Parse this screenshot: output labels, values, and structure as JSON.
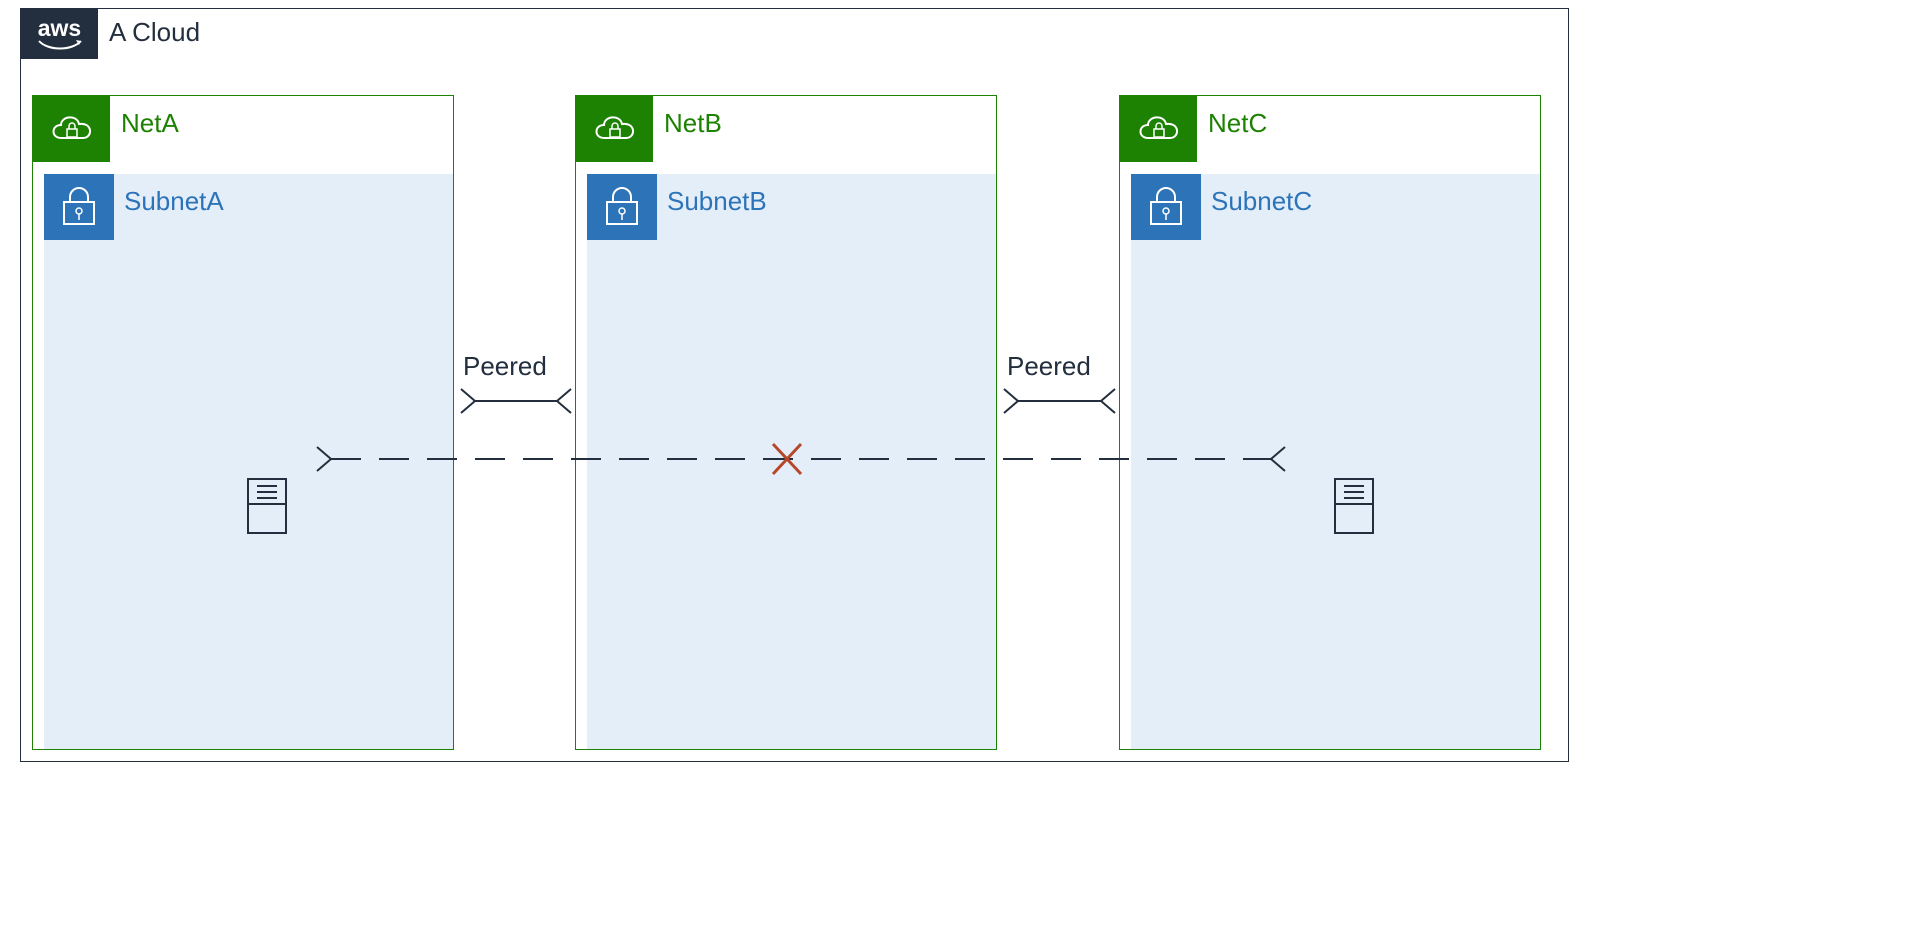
{
  "cloud": {
    "title": "A Cloud",
    "provider": "aws"
  },
  "vpcs": {
    "a": {
      "name": "NetA",
      "subnet": "SubnetA"
    },
    "b": {
      "name": "NetB",
      "subnet": "SubnetB"
    },
    "c": {
      "name": "NetC",
      "subnet": "SubnetC"
    }
  },
  "connections": {
    "ab": {
      "label": "Peered"
    },
    "bc": {
      "label": "Peered"
    },
    "ac_blocked": true
  },
  "colors": {
    "frame": "#232F3E",
    "vpc": "#1D8102",
    "subnet_bg": "#E3EEF9",
    "subnet_badge": "#2C73B7",
    "blocked": "#B7472A"
  }
}
